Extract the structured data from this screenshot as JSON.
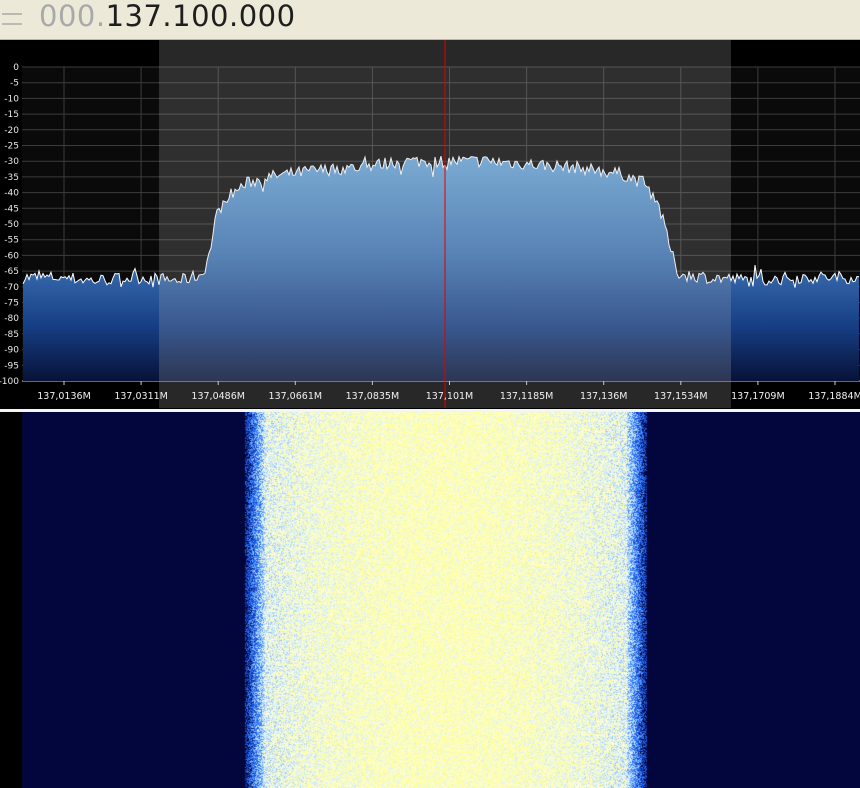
{
  "frequency_display": {
    "dim_digits": "000.",
    "active_digits": "137.100.000"
  },
  "spectrum": {
    "y_tick_labels": [
      "0",
      "-5",
      "-10",
      "-15",
      "-20",
      "-25",
      "-30",
      "-35",
      "-40",
      "-45",
      "-50",
      "-55",
      "-60",
      "-65",
      "-70",
      "-75",
      "-80",
      "-85",
      "-90",
      "-95",
      "-100"
    ],
    "x_tick_labels": [
      "137,0136M",
      "137,0311M",
      "137,0486M",
      "137,0661M",
      "137,0835M",
      "137,101M",
      "137,1185M",
      "137,136M",
      "137,1534M",
      "137,1709M",
      "137,1884M"
    ],
    "colors": {
      "background": "#000000",
      "plot_area": "#2a2a2a",
      "filter_band": "#7a7a7a",
      "trace": "#ffffff",
      "center_line": "#e00000",
      "fill_top": "#5f9fd6",
      "fill_bottom": "#0a1a4a"
    }
  },
  "chart_data": {
    "type": "area",
    "title": "",
    "xlabel": "",
    "ylabel": "",
    "x_unit": "MHz",
    "xlim": [
      137.0136,
      137.1884
    ],
    "ylim": [
      -100,
      0
    ],
    "grid": true,
    "center_frequency": 137.101,
    "filter_band": [
      137.0311,
      137.1709
    ],
    "series": [
      {
        "x": [
          137.0136,
          137.02,
          137.03,
          137.04,
          137.045,
          137.0465,
          137.048,
          137.05,
          137.055,
          137.06,
          137.07,
          137.08,
          137.09,
          137.101,
          137.11,
          137.12,
          137.13,
          137.14,
          137.145,
          137.148,
          137.15,
          137.1515,
          137.153,
          137.16,
          137.17,
          137.18,
          137.1884
        ],
        "values": [
          -67,
          -68,
          -67,
          -68,
          -66,
          -60,
          -48,
          -42,
          -37,
          -35,
          -33,
          -32,
          -30,
          -30,
          -30,
          -31,
          -32,
          -34,
          -37,
          -42,
          -52,
          -60,
          -66,
          -67,
          -68,
          -67,
          -67
        ]
      }
    ]
  },
  "waterfall": {
    "colors": {
      "background": "#00052e",
      "edge": "#1a2aa0",
      "mid": "#6fa0ff",
      "hot": "#f4f6c0"
    }
  }
}
